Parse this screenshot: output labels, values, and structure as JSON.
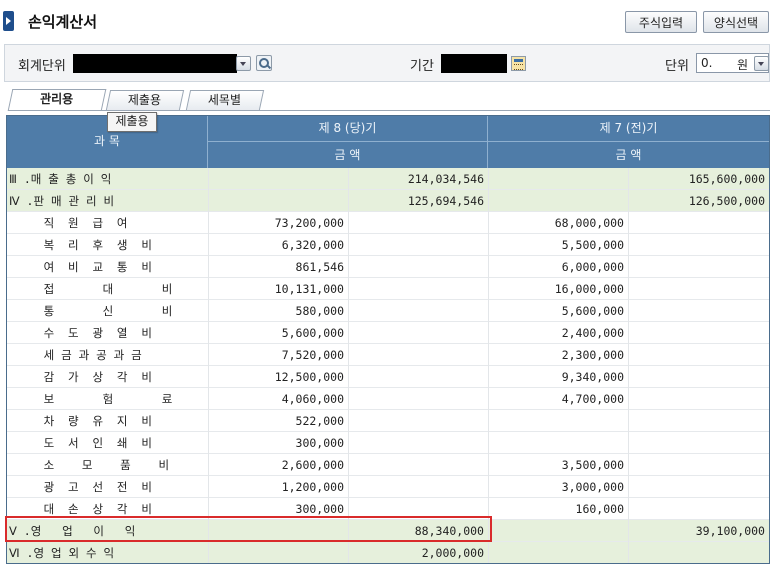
{
  "window": {
    "title": "손익계산서"
  },
  "toolbar": {
    "stock_input_label": "주식입력",
    "form_select_label": "양식선택"
  },
  "filters": {
    "unit_label": "회계단위",
    "period_label": "기간",
    "display_unit_label": "단위",
    "display_unit_value": "0.",
    "display_unit_suffix": "원"
  },
  "tabs": [
    {
      "label": "관리용",
      "active": true
    },
    {
      "label": "제출용",
      "active": false
    },
    {
      "label": "세목별",
      "active": false
    }
  ],
  "tooltip": {
    "text": "제출용"
  },
  "table": {
    "subject_header": "과   목",
    "period_current_header": "제 8 (당)기",
    "period_previous_header": "제 7 (전)기",
    "amount_header_1": "금    액",
    "amount_header_2": "금    액",
    "rows": [
      {
        "subject": "Ⅲ .매 출 총 이 익",
        "c_detail": "",
        "c_total": "214,034,546",
        "p_detail": "",
        "p_total": "165,600,000",
        "style": "green"
      },
      {
        "subject": "Ⅳ .판 매 관 리 비",
        "c_detail": "",
        "c_total": "125,694,546",
        "p_detail": "",
        "p_total": "126,500,000",
        "style": "green"
      },
      {
        "subject": "     직  원  급  여",
        "c_detail": "73,200,000",
        "c_total": "",
        "p_detail": "68,000,000",
        "p_total": "",
        "style": "white"
      },
      {
        "subject": "     복  리  후  생  비",
        "c_detail": "6,320,000",
        "c_total": "",
        "p_detail": "5,500,000",
        "p_total": "",
        "style": "white"
      },
      {
        "subject": "     여  비  교  통  비",
        "c_detail": "861,546",
        "c_total": "",
        "p_detail": "6,000,000",
        "p_total": "",
        "style": "white"
      },
      {
        "subject": "     접       대       비",
        "c_detail": "10,131,000",
        "c_total": "",
        "p_detail": "16,000,000",
        "p_total": "",
        "style": "white"
      },
      {
        "subject": "     통       신       비",
        "c_detail": "580,000",
        "c_total": "",
        "p_detail": "5,600,000",
        "p_total": "",
        "style": "white"
      },
      {
        "subject": "     수  도  광  열  비",
        "c_detail": "5,600,000",
        "c_total": "",
        "p_detail": "2,400,000",
        "p_total": "",
        "style": "white"
      },
      {
        "subject": "     세 금 과 공 과 금",
        "c_detail": "7,520,000",
        "c_total": "",
        "p_detail": "2,300,000",
        "p_total": "",
        "style": "white"
      },
      {
        "subject": "     감  가  상  각  비",
        "c_detail": "12,500,000",
        "c_total": "",
        "p_detail": "9,340,000",
        "p_total": "",
        "style": "white"
      },
      {
        "subject": "     보       험       료",
        "c_detail": "4,060,000",
        "c_total": "",
        "p_detail": "4,700,000",
        "p_total": "",
        "style": "white"
      },
      {
        "subject": "     차  량  유  지  비",
        "c_detail": "522,000",
        "c_total": "",
        "p_detail": "",
        "p_total": "",
        "style": "white"
      },
      {
        "subject": "     도  서  인  쇄  비",
        "c_detail": "300,000",
        "c_total": "",
        "p_detail": "",
        "p_total": "",
        "style": "white"
      },
      {
        "subject": "     소    모    품    비",
        "c_detail": "2,600,000",
        "c_total": "",
        "p_detail": "3,500,000",
        "p_total": "",
        "style": "white"
      },
      {
        "subject": "     광  고  선  전  비",
        "c_detail": "1,200,000",
        "c_total": "",
        "p_detail": "3,000,000",
        "p_total": "",
        "style": "white"
      },
      {
        "subject": "     대  손  상  각  비",
        "c_detail": "300,000",
        "c_total": "",
        "p_detail": "160,000",
        "p_total": "",
        "style": "white"
      },
      {
        "subject": "Ⅴ .영   업   이   익",
        "c_detail": "",
        "c_total": "88,340,000",
        "p_detail": "",
        "p_total": "39,100,000",
        "style": "green"
      },
      {
        "subject": "Ⅵ .영 업 외 수 익",
        "c_detail": "",
        "c_total": "2,000,000",
        "p_detail": "",
        "p_total": "",
        "style": "green"
      }
    ]
  },
  "colors": {
    "header_bg": "#4f7ca8",
    "summary_row_bg": "#e6f0dc",
    "highlight_border": "#d92b2b"
  }
}
